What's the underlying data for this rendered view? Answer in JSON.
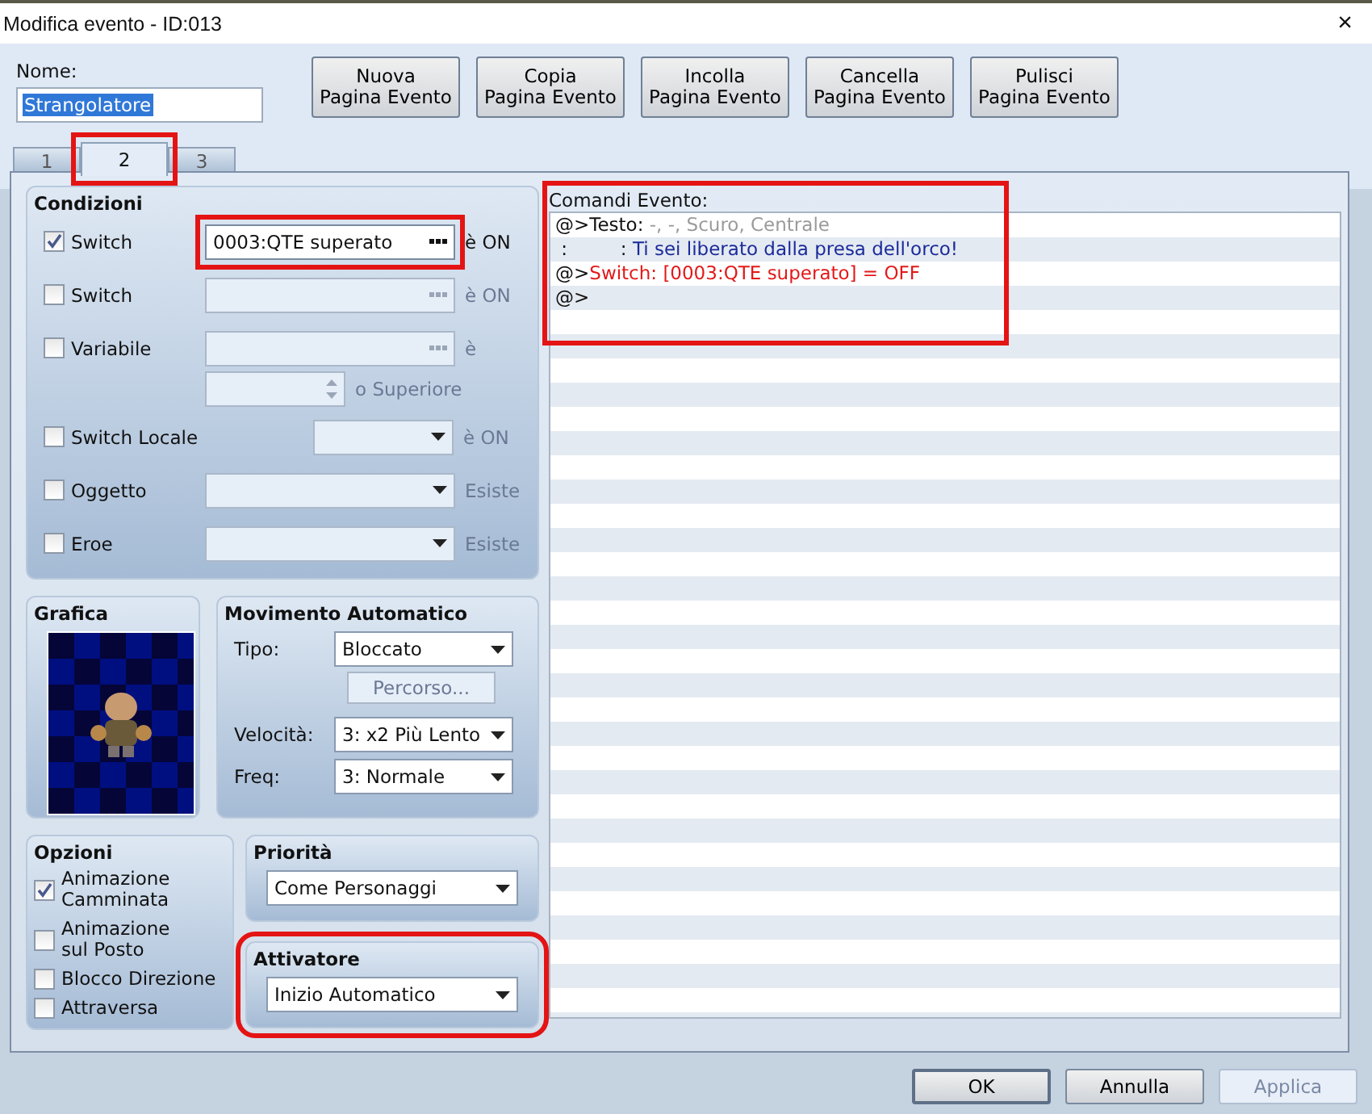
{
  "window": {
    "title": "Modifica evento - ID:013",
    "close": "×"
  },
  "name": {
    "label": "Nome:",
    "value": "Strangolatore"
  },
  "page_buttons": [
    {
      "line1": "Nuova",
      "line2": "Pagina Evento"
    },
    {
      "line1": "Copia",
      "line2": "Pagina Evento"
    },
    {
      "line1": "Incolla",
      "line2": "Pagina Evento"
    },
    {
      "line1": "Cancella",
      "line2": "Pagina Evento"
    },
    {
      "line1": "Pulisci",
      "line2": "Pagina Evento"
    }
  ],
  "tabs": [
    {
      "label": "1",
      "selected": false,
      "highlighted": false
    },
    {
      "label": "2",
      "selected": true,
      "highlighted": true
    },
    {
      "label": "3",
      "selected": false,
      "highlighted": false
    }
  ],
  "conditions": {
    "title": "Condizioni",
    "rows": [
      {
        "kind": "browse",
        "label": "Switch",
        "checked": true,
        "value": "0003:QTE superato",
        "suffix": "è ON",
        "highlighted": true
      },
      {
        "kind": "browse",
        "label": "Switch",
        "checked": false,
        "suffix": "è ON",
        "highlighted": false
      },
      {
        "kind": "browse",
        "label": "Variabile",
        "checked": false,
        "suffix": "è",
        "highlighted": false
      },
      {
        "kind": "spin",
        "suffix": "o Superiore",
        "highlighted": false
      },
      {
        "kind": "short-dropdown",
        "label": "Switch Locale",
        "checked": false,
        "suffix": "è ON",
        "highlighted": false
      },
      {
        "kind": "dropdown",
        "label": "Oggetto",
        "checked": false,
        "suffix": "Esiste",
        "highlighted": false
      },
      {
        "kind": "dropdown",
        "label": "Eroe",
        "checked": false,
        "suffix": "Esiste",
        "highlighted": false
      }
    ]
  },
  "graphic": {
    "title": "Grafica"
  },
  "movement": {
    "title": "Movimento Automatico",
    "type_label": "Tipo:",
    "type": "Bloccato",
    "route_button": "Percorso...",
    "route_disabled": true,
    "speed_label": "Velocità:",
    "speed": "3: x2 Più Lento",
    "freq_label": "Freq:",
    "freq": "3: Normale"
  },
  "options": {
    "title": "Opzioni",
    "items": [
      {
        "label": "Animazione\nCamminata",
        "checked": true
      },
      {
        "label": "Animazione\nsul Posto",
        "checked": false
      },
      {
        "label": "Blocco Direzione",
        "checked": false
      },
      {
        "label": "Attraversa",
        "checked": false
      }
    ]
  },
  "priority": {
    "title": "Priorità",
    "value": "Come Personaggi",
    "highlighted": false
  },
  "trigger": {
    "title": "Attivatore",
    "value": "Inizio Automatico",
    "highlighted": true
  },
  "commands": {
    "title": "Comandi Evento:",
    "highlighted": true,
    "lines": [
      {
        "segments": [
          {
            "kind": "plain",
            "text": "@>Testo: "
          },
          {
            "kind": "muted",
            "text": "-, -, Scuro, Centrale"
          }
        ]
      },
      {
        "segments": [
          {
            "kind": "plain",
            "text": " :         : "
          },
          {
            "kind": "blue",
            "text": "Ti sei liberato dalla presa dell'orco!"
          }
        ]
      },
      {
        "segments": [
          {
            "kind": "plain",
            "text": "@>"
          },
          {
            "kind": "red",
            "text": "Switch: [0003:QTE superato] = OFF"
          }
        ]
      },
      {
        "segments": [
          {
            "kind": "plain",
            "text": "@>"
          }
        ]
      }
    ]
  },
  "footer": [
    {
      "label": "OK",
      "kind": "default",
      "disabled": false
    },
    {
      "label": "Annulla",
      "kind": "normal",
      "disabled": false
    },
    {
      "label": "Applica",
      "kind": "normal",
      "disabled": true
    }
  ]
}
